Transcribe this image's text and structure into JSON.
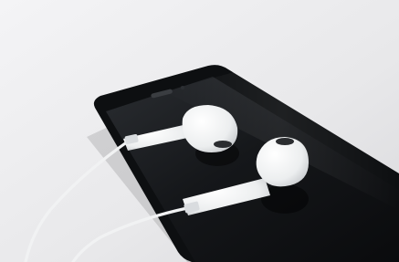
{
  "image": {
    "subject": "white-earbuds-on-black-smartphone",
    "colors": {
      "background": "#e9e9eb",
      "phone_body": "#0d0f11",
      "phone_screen": "#1c1f22",
      "earbud": "#f4f5f6",
      "cable": "#f2f3f4"
    }
  }
}
